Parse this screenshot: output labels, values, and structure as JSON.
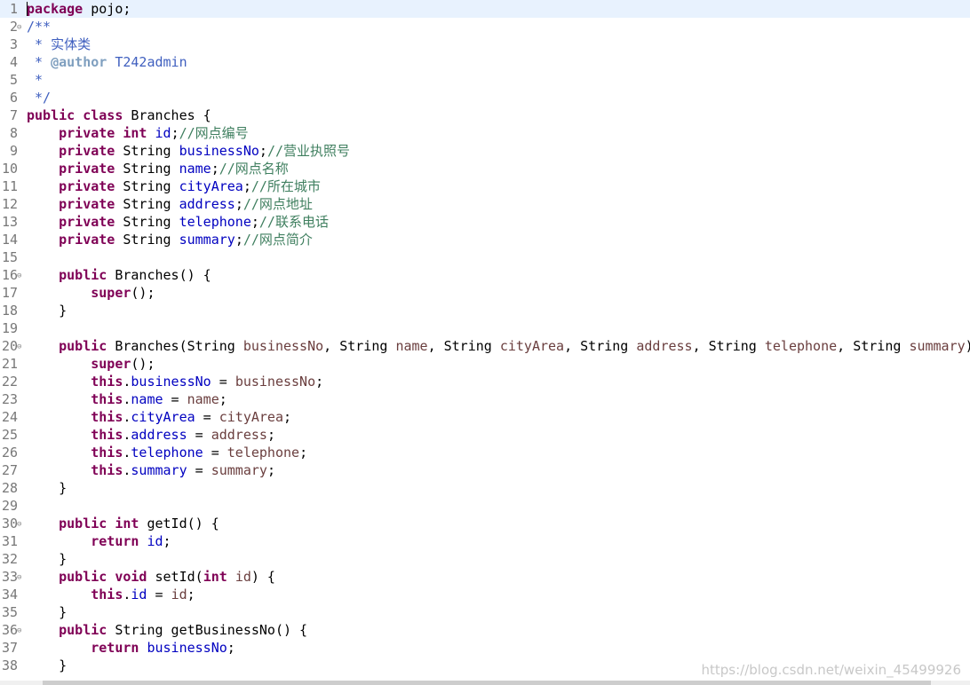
{
  "editor": {
    "language": "java",
    "lines": [
      {
        "n": "1",
        "code": "package pojo;"
      },
      {
        "n": "2",
        "code": "/**"
      },
      {
        "n": "3",
        "code": " * 实体类"
      },
      {
        "n": "4",
        "code": " * @author T242admin"
      },
      {
        "n": "5",
        "code": " *"
      },
      {
        "n": "6",
        "code": " */"
      },
      {
        "n": "7",
        "code": "public class Branches {"
      },
      {
        "n": "8",
        "code": "    private int id;//网点编号"
      },
      {
        "n": "9",
        "code": "    private String businessNo;//营业执照号"
      },
      {
        "n": "10",
        "code": "    private String name;//网点名称"
      },
      {
        "n": "11",
        "code": "    private String cityArea;//所在城市"
      },
      {
        "n": "12",
        "code": "    private String address;//网点地址"
      },
      {
        "n": "13",
        "code": "    private String telephone;//联系电话"
      },
      {
        "n": "14",
        "code": "    private String summary;//网点简介"
      },
      {
        "n": "15",
        "code": ""
      },
      {
        "n": "16",
        "code": "    public Branches() {"
      },
      {
        "n": "17",
        "code": "        super();"
      },
      {
        "n": "18",
        "code": "    }"
      },
      {
        "n": "19",
        "code": ""
      },
      {
        "n": "20",
        "code": "    public Branches(String businessNo, String name, String cityArea, String address, String telephone, String summary) {"
      },
      {
        "n": "21",
        "code": "        super();"
      },
      {
        "n": "22",
        "code": "        this.businessNo = businessNo;"
      },
      {
        "n": "23",
        "code": "        this.name = name;"
      },
      {
        "n": "24",
        "code": "        this.cityArea = cityArea;"
      },
      {
        "n": "25",
        "code": "        this.address = address;"
      },
      {
        "n": "26",
        "code": "        this.telephone = telephone;"
      },
      {
        "n": "27",
        "code": "        this.summary = summary;"
      },
      {
        "n": "28",
        "code": "    }"
      },
      {
        "n": "29",
        "code": ""
      },
      {
        "n": "30",
        "code": "    public int getId() {"
      },
      {
        "n": "31",
        "code": "        return id;"
      },
      {
        "n": "32",
        "code": "    }"
      },
      {
        "n": "33",
        "code": "    public void setId(int id) {"
      },
      {
        "n": "34",
        "code": "        this.id = id;"
      },
      {
        "n": "35",
        "code": "    }"
      },
      {
        "n": "36",
        "code": "    public String getBusinessNo() {"
      },
      {
        "n": "37",
        "code": "        return businessNo;"
      },
      {
        "n": "38",
        "code": "    }"
      }
    ],
    "fold_lines": [
      "2",
      "16",
      "20",
      "30",
      "33",
      "36"
    ],
    "fold_glyph": "⊖",
    "current_line": "1"
  },
  "watermark": "https://blog.csdn.net/weixin_45499926",
  "colors": {
    "background": "#ffffff",
    "current_line_highlight": "#e8f2fe",
    "line_number": "#787878",
    "keyword": "#7f0055",
    "field": "#0000c0",
    "comment": "#3f7f5f",
    "javadoc": "#3f5fbf",
    "javadoc_tag": "#7f9fbf",
    "parameter": "#6a3e3e"
  }
}
